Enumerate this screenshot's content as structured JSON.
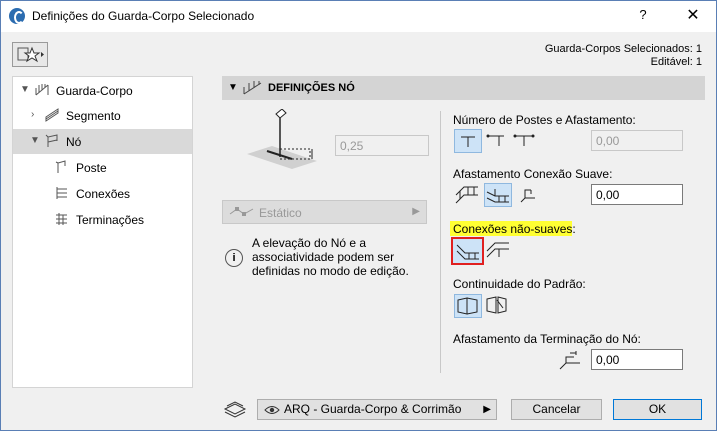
{
  "window": {
    "title": "Definições do Guarda-Corpo Selecionado",
    "help": "?",
    "close": "✕"
  },
  "info": {
    "selected": "Guarda-Corpos Selecionados: 1",
    "editable": "Editável: 1"
  },
  "tree": [
    {
      "label": "Guarda-Corpo"
    },
    {
      "label": "Segmento"
    },
    {
      "label": "Nó"
    },
    {
      "label": "Poste"
    },
    {
      "label": "Conexões"
    },
    {
      "label": "Terminações"
    }
  ],
  "section": {
    "title": "DEFINIÇÕES NÓ"
  },
  "left": {
    "elevation_value": "0,25",
    "static_label": "Estático",
    "note": "A elevação do Nó e a associatividade podem ser definidas no modo de edição."
  },
  "right": {
    "posts_label": "Número de Postes e Afastamento:",
    "posts_value": "0,00",
    "smooth_label": "Afastamento Conexão Suave:",
    "smooth_value": "0,00",
    "nonsmooth_label": "Conexões não-suaves:",
    "continuity_label": "Continuidade do Padrão:",
    "termination_label": "Afastamento da Terminação do Nó:",
    "termination_value": "0,00"
  },
  "footer": {
    "layer": "ARQ - Guarda-Corpo & Corrimão",
    "cancel": "Cancelar",
    "ok": "OK"
  },
  "colors": {
    "highlight": "#ffff33",
    "selection": "#cde3f7",
    "red_frame": "#e02020"
  }
}
